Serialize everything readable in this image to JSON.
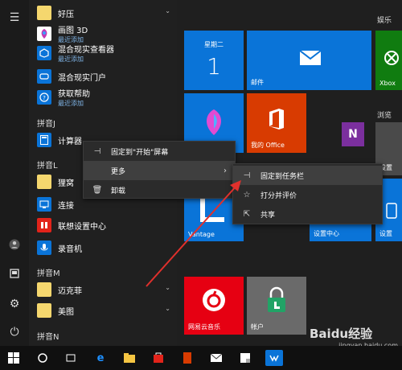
{
  "applist": {
    "group_top": "好压",
    "items_a": [
      {
        "label": "画图 3D",
        "sub": "最近添加"
      },
      {
        "label": "混合现实查看器",
        "sub": "最近添加"
      },
      {
        "label": "混合现实门户",
        "sub": ""
      },
      {
        "label": "获取帮助",
        "sub": "最近添加"
      }
    ],
    "hdr_j": "拼音J",
    "jisuanji": "计算器",
    "hdr_l": "拼音L",
    "l_items": [
      "狸窝",
      "连接",
      "联想设置中心",
      "录音机"
    ],
    "hdr_m": "拼音M",
    "m_items": [
      "迈克菲",
      "美图"
    ],
    "hdr_n": "拼音N"
  },
  "tiles": {
    "group_entertain": "娱乐",
    "group_browse": "浏览",
    "calendar_day": "星期二",
    "calendar_date": "1",
    "mail": "邮件",
    "office": "我的 Office",
    "xbox": "Xbox",
    "vantage": "Vantage",
    "settings_center": "设置中心",
    "cloud_music": "网易云音乐",
    "account": "帐户",
    "right_tile_a": "设置",
    "right_tile_b": "设置"
  },
  "context_menu": {
    "pin_start": "固定到\"开始\"屏幕",
    "more": "更多",
    "uninstall": "卸载"
  },
  "submenu": {
    "pin_taskbar": "固定到任务栏",
    "rate_review": "打分并评价",
    "share": "共享"
  },
  "watermark": {
    "brand": "Baidu经验",
    "url": "jingyan.baidu.com"
  },
  "colors": {
    "tile_blue": "#0a74d8",
    "office_red": "#d83b01",
    "onenote_purple": "#7b2f9e",
    "music_red": "#e60012",
    "account_gray": "#6a6a6a",
    "arrow": "#e0302c"
  }
}
